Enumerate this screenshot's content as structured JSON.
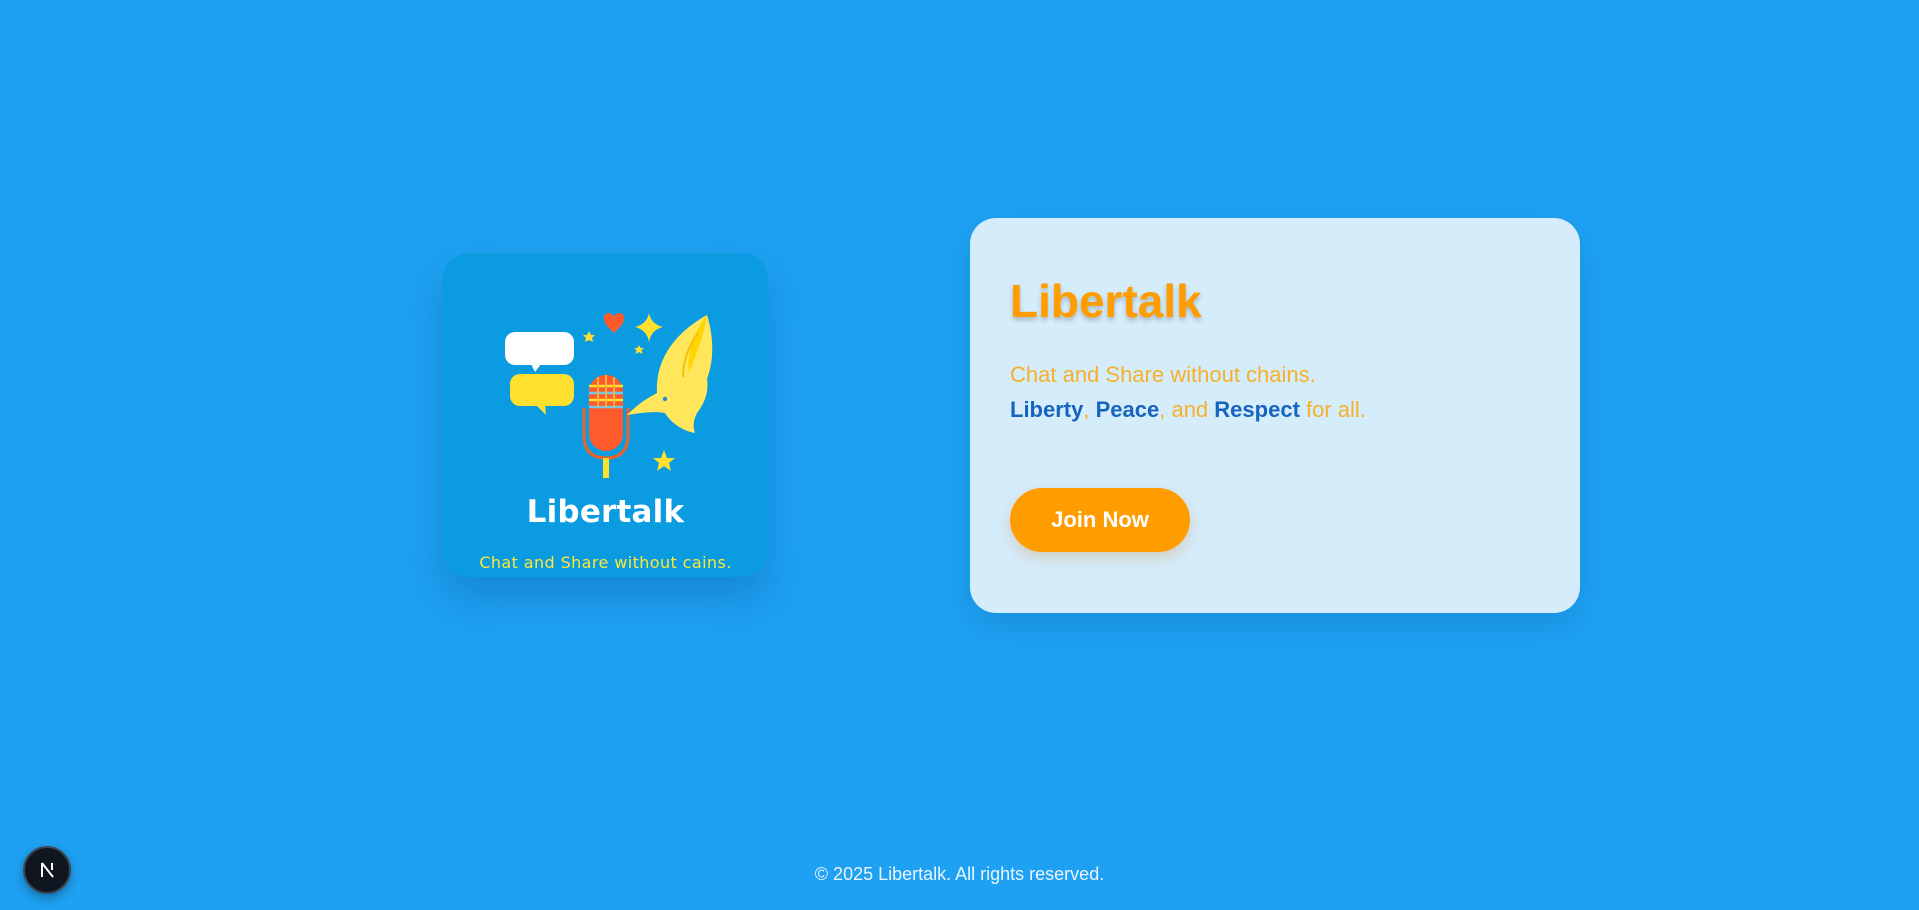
{
  "logo": {
    "name": "Libertalk",
    "tagline": "Chat and Share without cains."
  },
  "hero": {
    "title": "Libertalk",
    "subtitle": "Chat and Share without chains.",
    "values_line": {
      "word1": "Liberty",
      "sep1": ",",
      "word2": "Peace",
      "sep2": ", and",
      "word3": "Respect",
      "suffix": "for all."
    },
    "cta_label": "Join Now"
  },
  "footer": {
    "copyright": "© 2025 Libertalk. All rights reserved."
  },
  "dev_badge": {
    "letter": "N",
    "icon": "nextjs-icon"
  },
  "colors": {
    "background": "#1ea1f2",
    "accent_orange": "#ff9c00",
    "keyword_blue": "#1565c0",
    "card_bg": "#d5ecfa",
    "logo_bg": "#0a9be0"
  }
}
